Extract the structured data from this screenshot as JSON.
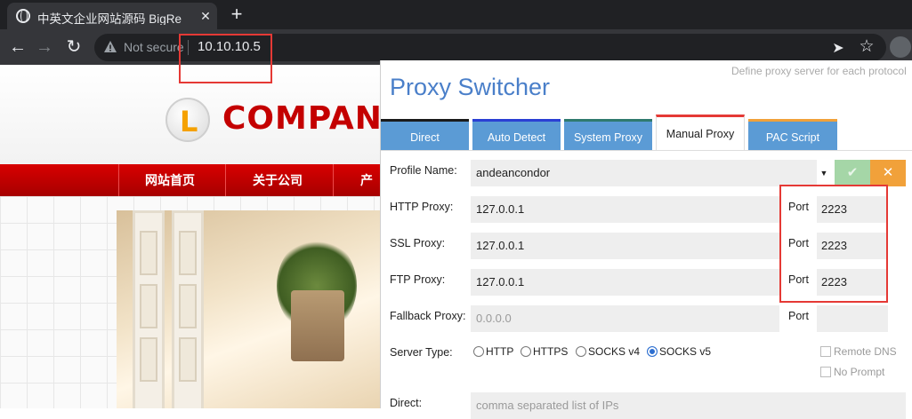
{
  "browser": {
    "tab_title": "中英文企业网站源码 BigRe",
    "tab_close": "✕",
    "new_tab": "+",
    "security_label": "Not secure",
    "url": "10.10.10.5"
  },
  "site": {
    "logo_letter": "L",
    "logo_text": "COMPANY",
    "nav": [
      "网站首页",
      "关于公司",
      "产"
    ]
  },
  "proxy_switcher": {
    "subtitle": "Define proxy server for each protocol",
    "title": "Proxy Switcher",
    "tabs": [
      {
        "label": "Direct",
        "color": "#1a1a1a",
        "bg": "#5b9bd5",
        "active": false
      },
      {
        "label": "Auto Detect",
        "color": "#2a3fd4",
        "bg": "#5b9bd5",
        "active": false
      },
      {
        "label": "System Proxy",
        "color": "#2f7a6e",
        "bg": "#5b9bd5",
        "active": false
      },
      {
        "label": "Manual Proxy",
        "color": "#e53935",
        "bg": "#ffffff",
        "active": true
      },
      {
        "label": "PAC Script",
        "color": "#f1a13a",
        "bg": "#5b9bd5",
        "active": false
      }
    ],
    "profile": {
      "label": "Profile Name:",
      "value": "andeancondor",
      "save": "✔",
      "cancel": "✕"
    },
    "http": {
      "label": "HTTP Proxy:",
      "host": "127.0.0.1",
      "port_label": "Port",
      "port": "2223"
    },
    "ssl": {
      "label": "SSL Proxy:",
      "host": "127.0.0.1",
      "port_label": "Port",
      "port": "2223"
    },
    "ftp": {
      "label": "FTP Proxy:",
      "host": "127.0.0.1",
      "port_label": "Port",
      "port": "2223"
    },
    "fallback": {
      "label": "Fallback Proxy:",
      "host_placeholder": "0.0.0.0",
      "port_label": "Port",
      "port": ""
    },
    "server_type": {
      "label": "Server Type:",
      "options": [
        "HTTP",
        "HTTPS",
        "SOCKS v4",
        "SOCKS v5"
      ],
      "selected": "SOCKS v5"
    },
    "remote_dns": {
      "label": "Remote DNS",
      "checked": false
    },
    "no_prompt": {
      "label": "No Prompt",
      "checked": false
    },
    "direct": {
      "label": "Direct:",
      "placeholder": "comma separated list of IPs"
    }
  }
}
